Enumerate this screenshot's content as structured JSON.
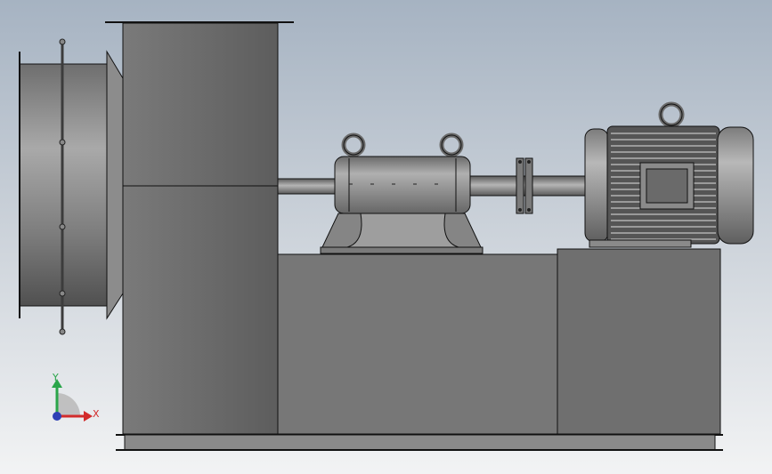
{
  "view": {
    "triad": {
      "x_label": "X",
      "y_label": "Y",
      "x_color": "#d22b2b",
      "y_color": "#2aa54a",
      "z_color": "#2d3fb5"
    }
  },
  "colors": {
    "steel_dark": "#4b4b4b",
    "steel_mid": "#7a7a7a",
    "steel_light": "#a8a8a8",
    "outline": "#101010"
  },
  "icons": [
    "coordinate-triad-icon"
  ]
}
